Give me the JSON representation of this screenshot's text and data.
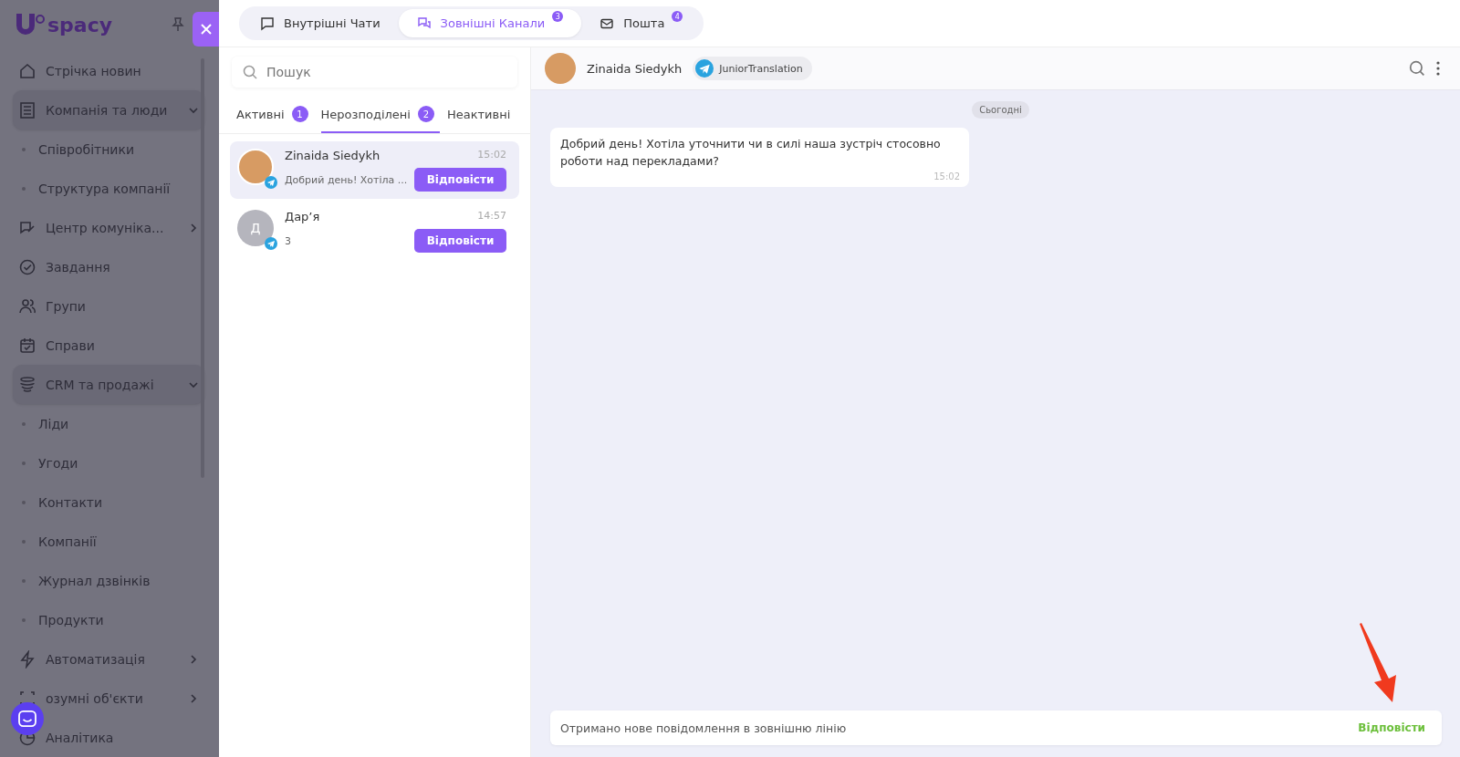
{
  "sidebar": {
    "logo": "spacy",
    "items": [
      {
        "kind": "item",
        "label": "Стрічка новин"
      },
      {
        "kind": "group",
        "label": "Компанія та люди",
        "expanded": true,
        "children": [
          {
            "label": "Співробітники"
          },
          {
            "label": "Структура компанії"
          }
        ]
      },
      {
        "kind": "group",
        "label": "Центр комуніка...",
        "expanded": false
      },
      {
        "kind": "item",
        "label": "Завдання"
      },
      {
        "kind": "item",
        "label": "Групи"
      },
      {
        "kind": "item",
        "label": "Справи"
      },
      {
        "kind": "group",
        "label": "CRM та продажі",
        "expanded": true,
        "children": [
          {
            "label": "Ліди"
          },
          {
            "label": "Угоди"
          },
          {
            "label": "Контакти"
          },
          {
            "label": "Компанії"
          },
          {
            "label": "Журнал дзвінків"
          },
          {
            "label": "Продукти"
          }
        ]
      },
      {
        "kind": "group",
        "label": "Автоматизація",
        "expanded": false
      },
      {
        "kind": "group",
        "label": "озумні об'єкти",
        "expanded": false
      },
      {
        "kind": "item",
        "label": "Аналітика"
      }
    ]
  },
  "top_tabs": [
    {
      "label": "Внутрішні Чати",
      "selected": false
    },
    {
      "label": "Зовнішні Канали",
      "badge": "3",
      "selected": true
    },
    {
      "label": "Пошта",
      "badge": "4",
      "selected": false
    }
  ],
  "chat_list": {
    "search": {
      "placeholder": "Пошук"
    },
    "tabs": [
      {
        "label": "Активні",
        "badge": "1",
        "selected": false
      },
      {
        "label": "Нерозподілені",
        "badge": "2",
        "selected": true
      },
      {
        "label": "Неактивні",
        "selected": false
      }
    ],
    "chats": [
      {
        "name": "Zinaida Siedykh",
        "time": "15:02",
        "preview": "Добрий день! Хотіла ...",
        "button": "Відповісти",
        "selected": true
      },
      {
        "name": "Дар’я",
        "initial": "Д",
        "time": "14:57",
        "preview": "3",
        "button": "Відповісти",
        "selected": false
      }
    ]
  },
  "conversation": {
    "name": "Zinaida Siedykh",
    "channel": "JuniorTranslation",
    "date": "Сьогодні",
    "messages": [
      {
        "text": "Добрий день! Хотіла уточнити чи в силі наша зустріч стосовно роботи над перекладами?",
        "time": "15:02"
      }
    ],
    "notice": {
      "text": "Отримано нове повідомлення в зовнішню лінію",
      "action": "Відповісти"
    }
  }
}
